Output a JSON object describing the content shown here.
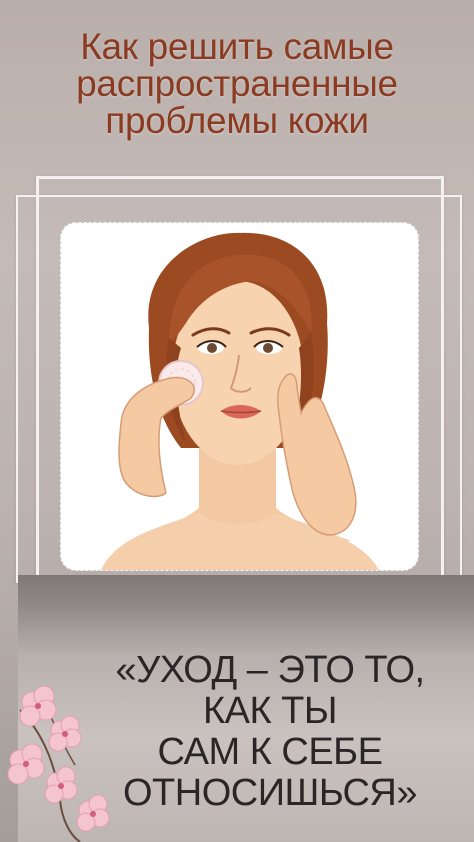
{
  "title": {
    "line1": "Как решить самые",
    "line2": "распространенные",
    "line3": "проблемы кожи"
  },
  "illustration": {
    "subject": "woman-applying-cotton-pad-icon"
  },
  "quote": {
    "line1": "«УХОД – ЭТО ТО,",
    "line2": "КАК ТЫ",
    "line3": "САМ К СЕБЕ",
    "line4": "ОТНОСИШЬСЯ»"
  },
  "decor": {
    "flowers": "cherry-blossom-icon"
  },
  "colors": {
    "title": "#8a3b21",
    "background": "#c0b7b4",
    "quote_text": "#2a2627",
    "frame": "#f4f1f0"
  }
}
